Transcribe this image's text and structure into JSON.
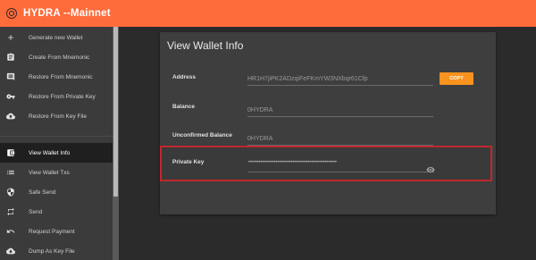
{
  "app": {
    "title": "HYDRA --Mainnet",
    "accent": "#ff6c3b"
  },
  "sidebar": {
    "items": [
      {
        "label": "Generate new Wallet",
        "icon": "plus-icon"
      },
      {
        "label": "Create From Mnemonic",
        "icon": "clipboard-icon"
      },
      {
        "label": "Restore From Mnemonic",
        "icon": "comment-icon"
      },
      {
        "label": "Restore From Private Key",
        "icon": "key-icon"
      },
      {
        "label": "Restore From Key File",
        "icon": "cloud-upload-icon"
      },
      {
        "label": "View Wallet Info",
        "icon": "wallet-icon",
        "active": true
      },
      {
        "label": "View Wallet Txs",
        "icon": "list-icon"
      },
      {
        "label": "Safe Send",
        "icon": "shield-icon"
      },
      {
        "label": "Send",
        "icon": "swap-icon"
      },
      {
        "label": "Request Payment",
        "icon": "undo-icon"
      },
      {
        "label": "Dump As Key File",
        "icon": "cloud-download-icon"
      }
    ]
  },
  "wallet_info": {
    "title": "View Wallet Info",
    "address_label": "Address",
    "address_value": "HR1H7jiPK2ADzqiFeFKmYW3NXbqr61Cfp",
    "copy_label": "COPY",
    "balance_label": "Balance",
    "balance_value": "0HYDRA",
    "unconfirmed_label": "Unconfirmed Balance",
    "unconfirmed_value": "0HYDRA",
    "private_key_label": "Private Key",
    "private_key_masked": "••••••••••••••••••••••••••••••••••••••••••••••••••••",
    "highlight_color": "#c0282d",
    "copy_button_color": "#f7931e"
  }
}
